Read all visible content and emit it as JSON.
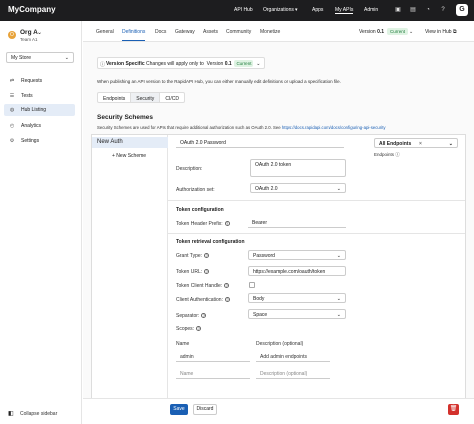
{
  "topbar": {
    "brand": "MyCompany",
    "nav": [
      "API Hub",
      "Organizations",
      "Apps",
      "My APIs",
      "Admin"
    ],
    "avatar": "G"
  },
  "sidebar": {
    "org_avatar": "O",
    "org_name": "Org A",
    "team": "Team A1",
    "store": "My Store",
    "items": [
      {
        "label": "Requests",
        "icon": "requests-icon"
      },
      {
        "label": "Tests",
        "icon": "tests-icon"
      },
      {
        "label": "Hub Listing",
        "icon": "globe-icon"
      },
      {
        "label": "Analytics",
        "icon": "analytics-icon"
      },
      {
        "label": "Settings",
        "icon": "gear-icon"
      }
    ],
    "collapse": "Collapse sidebar"
  },
  "tabs": [
    "General",
    "Definitions",
    "Docs",
    "Gateway",
    "Assets",
    "Community",
    "Monetize"
  ],
  "version": {
    "label": "Version",
    "value": "0.1",
    "badge": "Current",
    "view_in_hub": "View in Hub"
  },
  "version_bar": {
    "prefix": "Version Specific",
    "text": "Changes will apply only to",
    "version_label": "Version",
    "version": "0.1",
    "badge": "Current"
  },
  "note": "When publishing an API version to the RapidAPI Hub, you can either manually edit definitions or upload a specification file.",
  "sub_tabs": [
    "Endpoints",
    "Security",
    "CI/CD"
  ],
  "security": {
    "title": "Security Schemes",
    "desc": "Security Schemes are used for APIs that require additional authorization such as OAuth 2.0. See",
    "link": "https://docs.rapidapi.com/docs/configuring-api-security"
  },
  "schemes": {
    "selected": "New Auth",
    "new_label": "+ New Scheme"
  },
  "form": {
    "name": "OAuth 2.0 Password",
    "all_endpoints": "All Endpoints",
    "endpoints_label": "Endpoints",
    "description_label": "Description:",
    "description_value": "OAuth 2.0 token",
    "auth_label": "Authorization set:",
    "auth_value": "OAuth 2.0",
    "token_config": "Token configuration",
    "token_prefix_label": "Token Header Prefix:",
    "token_prefix_value": "Bearer",
    "token_retrieval": "Token retrieval configuration",
    "grant_label": "Grant Type:",
    "grant_value": "Password",
    "token_url_label": "Token URL:",
    "token_url_value": "https://example.com/oauth/token",
    "token_client_label": "Token Client Handle:",
    "client_auth_label": "Client Authentication:",
    "client_auth_value": "Body",
    "separator_label": "Separator:",
    "separator_value": "Space",
    "scopes_label": "Scopes:",
    "name_col": "Name",
    "desc_col": "Description (optional)",
    "scope_name": "admin",
    "scope_desc": "Add admin endpoints",
    "name_ph": "Name",
    "desc_ph": "Description (optional)"
  },
  "footer": {
    "save": "Save",
    "discard": "Discard"
  }
}
